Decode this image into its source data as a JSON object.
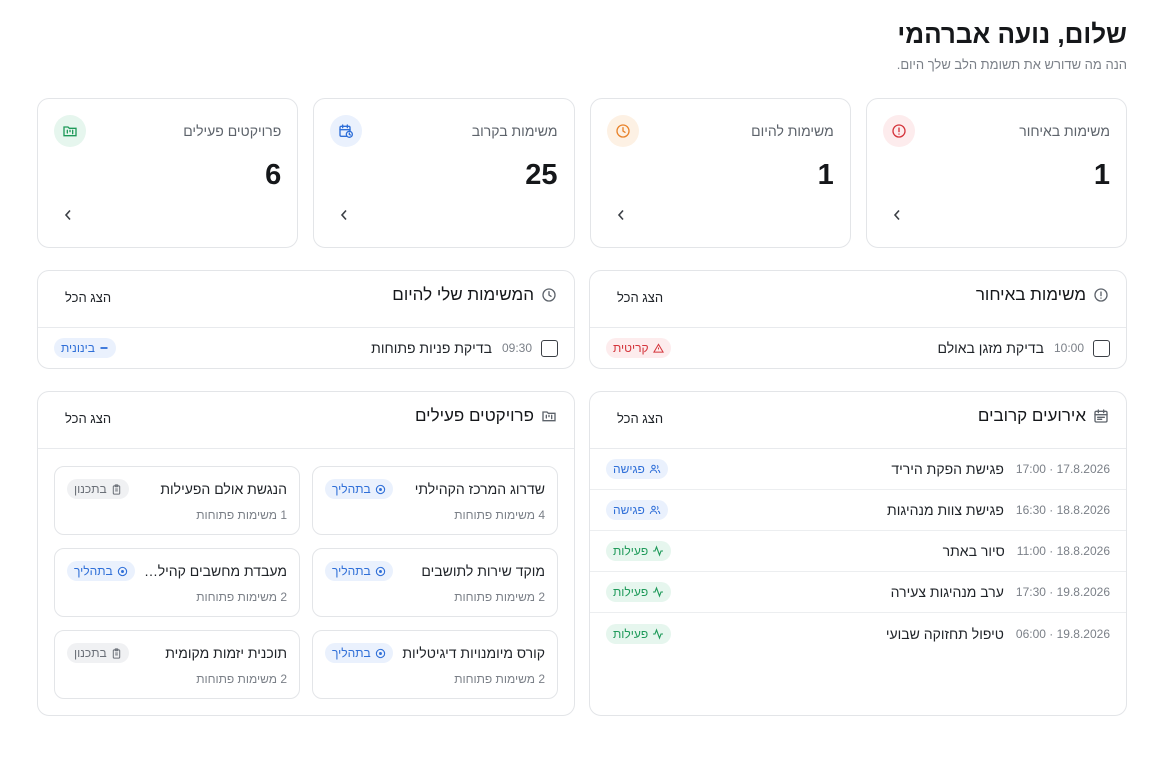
{
  "header": {
    "greeting": "שלום, נועה אברהמי",
    "subtitle": "הנה מה שדורש את תשומת הלב שלך היום."
  },
  "stats": [
    {
      "label": "משימות באיחור",
      "value": "1",
      "icon": "alert-circle-icon",
      "color": "#d4343b",
      "bg": "#fdeced"
    },
    {
      "label": "משימות להיום",
      "value": "1",
      "icon": "clock-icon",
      "color": "#e8822a",
      "bg": "#fdf1e4"
    },
    {
      "label": "משימות בקרוב",
      "value": "25",
      "icon": "calendar-clock-icon",
      "color": "#2f6fd8",
      "bg": "#eaf1fd"
    },
    {
      "label": "פרויקטים פעילים",
      "value": "6",
      "icon": "folder-kanban-icon",
      "color": "#1f9a5a",
      "bg": "#e6f6ee"
    }
  ],
  "overdue": {
    "title": "משימות באיחור",
    "show_all": "הצג הכל",
    "tasks": [
      {
        "time": "10:00",
        "title": "בדיקת מזגן באולם",
        "badge": "קריטית"
      }
    ]
  },
  "today": {
    "title": "המשימות שלי להיום",
    "show_all": "הצג הכל",
    "tasks": [
      {
        "time": "09:30",
        "title": "בדיקת פניות פתוחות",
        "badge": "בינונית"
      }
    ]
  },
  "events": {
    "title": "אירועים קרובים",
    "show_all": "הצג הכל",
    "items": [
      {
        "date": "17.8.2026 · 17:00",
        "title": "פגישת הפקת היריד",
        "badge": "פגישה",
        "kind": "meet"
      },
      {
        "date": "18.8.2026 · 16:30",
        "title": "פגישת צוות מנהיגות",
        "badge": "פגישה",
        "kind": "meet"
      },
      {
        "date": "18.8.2026 · 11:00",
        "title": "סיור באתר",
        "badge": "פעילות",
        "kind": "act"
      },
      {
        "date": "19.8.2026 · 17:30",
        "title": "ערב מנהיגות צעירה",
        "badge": "פעילות",
        "kind": "act"
      },
      {
        "date": "19.8.2026 · 06:00",
        "title": "טיפול תחזוקה שבועי",
        "badge": "פעילות",
        "kind": "act"
      }
    ]
  },
  "projects": {
    "title": "פרויקטים פעילים",
    "show_all": "הצג הכל",
    "items": [
      {
        "name": "שדרוג המרכז הקהילתי",
        "sub": "4 משימות פתוחות",
        "badge": "בתהליך",
        "kind": "prog"
      },
      {
        "name": "הנגשת אולם הפעילות",
        "sub": "1 משימות פתוחות",
        "badge": "בתכנון",
        "kind": "plan"
      },
      {
        "name": "מוקד שירות לתושבים",
        "sub": "2 משימות פתוחות",
        "badge": "בתהליך",
        "kind": "prog"
      },
      {
        "name": "מעבדת מחשבים קהילתית",
        "sub": "2 משימות פתוחות",
        "badge": "בתהליך",
        "kind": "prog"
      },
      {
        "name": "קורס מיומנויות דיגיטליות",
        "sub": "2 משימות פתוחות",
        "badge": "בתהליך",
        "kind": "prog"
      },
      {
        "name": "תוכנית יזמות מקומית",
        "sub": "2 משימות פתוחות",
        "badge": "בתכנון",
        "kind": "plan"
      }
    ]
  }
}
